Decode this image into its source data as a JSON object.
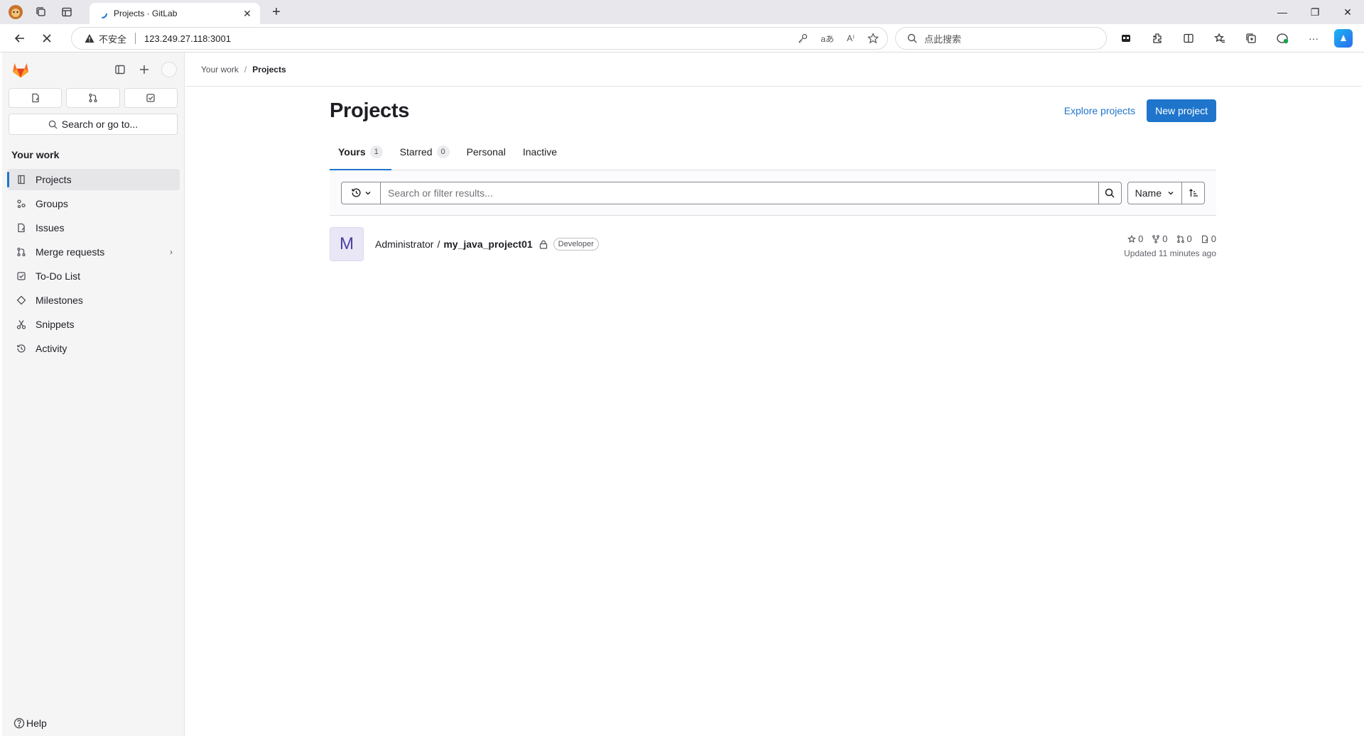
{
  "browser": {
    "tab_title": "Projects · GitLab",
    "security_label": "不安全",
    "url": "123.249.27.118:3001",
    "search_placeholder": "点此搜索"
  },
  "sidebar": {
    "search_label": "Search or go to...",
    "section_title": "Your work",
    "items": [
      {
        "label": "Projects"
      },
      {
        "label": "Groups"
      },
      {
        "label": "Issues"
      },
      {
        "label": "Merge requests"
      },
      {
        "label": "To-Do List"
      },
      {
        "label": "Milestones"
      },
      {
        "label": "Snippets"
      },
      {
        "label": "Activity"
      }
    ],
    "help_label": "Help"
  },
  "breadcrumb": {
    "parent": "Your work",
    "separator": "/",
    "current": "Projects"
  },
  "page": {
    "title": "Projects",
    "explore_label": "Explore projects",
    "new_project_label": "New project"
  },
  "tabs": [
    {
      "label": "Yours",
      "count": "1"
    },
    {
      "label": "Starred",
      "count": "0"
    },
    {
      "label": "Personal"
    },
    {
      "label": "Inactive"
    }
  ],
  "filter": {
    "placeholder": "Search or filter results...",
    "sort_label": "Name"
  },
  "project": {
    "avatar_letter": "M",
    "namespace": "Administrator",
    "separator": "/",
    "name": "my_java_project01",
    "role": "Developer",
    "stars": "0",
    "forks": "0",
    "merge_requests": "0",
    "issues": "0",
    "updated": "Updated 11 minutes ago"
  },
  "colors": {
    "accent": "#1f75cb",
    "gitlab_orange": "#fc6d26"
  }
}
